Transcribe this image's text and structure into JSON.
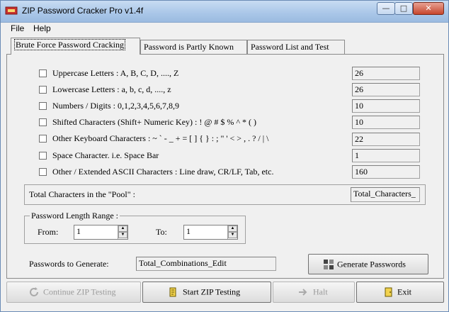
{
  "window": {
    "title": "ZIP Password Cracker Pro v1.4f",
    "caption_buttons": {
      "minimize": "—",
      "maximize": "□",
      "close": "✕"
    }
  },
  "menu": {
    "items": [
      "File",
      "Help"
    ]
  },
  "tabs": [
    {
      "label": "Brute Force Password Cracking",
      "active": true
    },
    {
      "label": "Password is Partly Known",
      "active": false
    },
    {
      "label": "Password List and Test",
      "active": false
    }
  ],
  "charsets": [
    {
      "label": "Uppercase Letters : A, B, C, D, ...., Z",
      "count": "26",
      "checked": false
    },
    {
      "label": "Lowercase Letters : a, b, c, d, ...., z",
      "count": "26",
      "checked": false
    },
    {
      "label": "Numbers / Digits : 0,1,2,3,4,5,6,7,8,9",
      "count": "10",
      "checked": false
    },
    {
      "label": "Shifted Characters (Shift+ Numeric Key) : ! @ # $ % ^ * ( )",
      "count": "10",
      "checked": false
    },
    {
      "label": "Other Keyboard Characters : ~ ` - _ + = [ ] { } : ; \" ' < > , . ? / | \\",
      "count": "22",
      "checked": false
    },
    {
      "label": "Space Character.  i.e. Space Bar",
      "count": "1",
      "checked": false
    },
    {
      "label": "Other / Extended ASCII Characters : Line draw, CR/LF, Tab, etc.",
      "count": "160",
      "checked": false
    }
  ],
  "pool": {
    "label": "Total Characters in the \"Pool\" :",
    "value": "Total_Characters_"
  },
  "length_range": {
    "title": "Password Length Range :",
    "from_label": "From:",
    "from_value": "1",
    "to_label": "To:",
    "to_value": "1"
  },
  "generate": {
    "label": "Passwords to Generate:",
    "value": "Total_Combinations_Edit",
    "button": "Generate Passwords"
  },
  "bottom_buttons": {
    "continue": "Continue ZIP Testing",
    "start": "Start ZIP Testing",
    "halt": "Halt",
    "exit": "Exit"
  },
  "colors": {
    "titlebar": "#a9c6e8",
    "close_button": "#c7462c",
    "panel": "#f0f0f0"
  }
}
